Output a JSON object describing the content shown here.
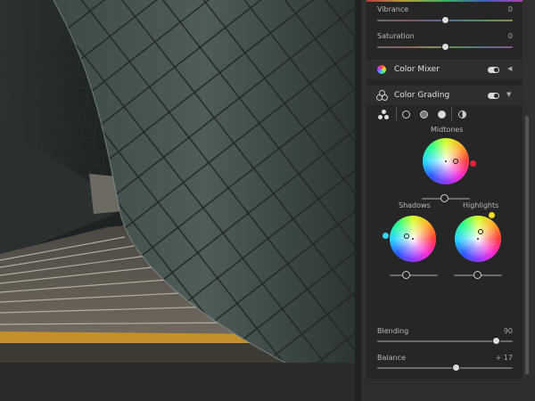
{
  "colors": {
    "panel_bg": "#262626",
    "accent_shadows_dot": "#3ad4e8",
    "accent_midtones_dot": "#e8203c",
    "accent_highlights_dot": "#f0dc1e"
  },
  "basic": {
    "vibrance": {
      "label": "Vibrance",
      "value": "0",
      "position": 0.5
    },
    "saturation": {
      "label": "Saturation",
      "value": "0",
      "position": 0.5
    }
  },
  "color_mixer": {
    "title": "Color Mixer",
    "icon": "color-mixer-icon",
    "enabled": true
  },
  "color_grading": {
    "title": "Color Grading",
    "icon": "color-grading-icon",
    "enabled": true,
    "modes": [
      "three-way",
      "shadows",
      "midtones",
      "highlights",
      "global"
    ],
    "midtones": {
      "label": "Midtones",
      "luminance": 0.5
    },
    "shadows": {
      "label": "Shadows",
      "luminance": 0.5
    },
    "highlights": {
      "label": "Highlights",
      "luminance": 0.5
    },
    "blending": {
      "label": "Blending",
      "value": "90",
      "position": 0.9
    },
    "balance": {
      "label": "Balance",
      "value": "+ 17",
      "position": 0.58
    }
  }
}
